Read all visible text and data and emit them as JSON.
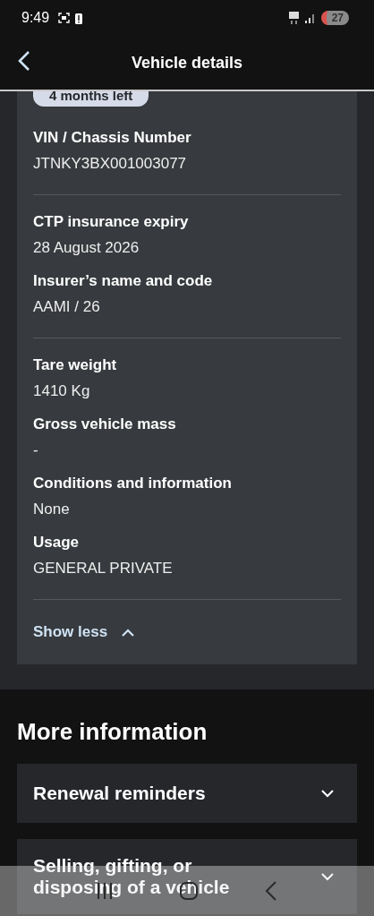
{
  "status_bar": {
    "time": "9:49",
    "battery": "27"
  },
  "header": {
    "title": "Vehicle details"
  },
  "details": {
    "badge": "4 months left",
    "groups": [
      [
        {
          "label": "VIN / Chassis Number",
          "value": "JTNKY3BX001003077"
        }
      ],
      [
        {
          "label": "CTP insurance expiry",
          "value": "28 August 2026"
        },
        {
          "label": "Insurer’s name and code",
          "value": "AAMI / 26"
        }
      ],
      [
        {
          "label": "Tare weight",
          "value": "1410 Kg"
        },
        {
          "label": "Gross vehicle mass",
          "value": "-"
        },
        {
          "label": "Conditions and information",
          "value": "None"
        },
        {
          "label": "Usage",
          "value": "GENERAL PRIVATE"
        }
      ]
    ],
    "toggle": {
      "label": "Show less",
      "expanded": true
    }
  },
  "more_information": {
    "title": "More information",
    "items": [
      {
        "label": "Renewal reminders",
        "expanded": false
      },
      {
        "label": "Selling, gifting, or disposing of a vehicle",
        "expanded": false
      }
    ]
  }
}
